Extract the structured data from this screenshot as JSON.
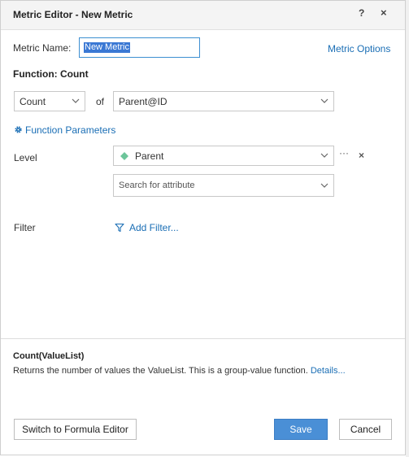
{
  "dialog": {
    "title": "Metric Editor - New Metric",
    "help_glyph": "?",
    "close_glyph": "×"
  },
  "metric": {
    "name_label": "Metric Name:",
    "name_value": "New Metric",
    "options_link": "Metric Options"
  },
  "function": {
    "heading": "Function: Count",
    "selected": "Count",
    "of_label": "of",
    "argument": "Parent@ID",
    "parameters_link": "Function Parameters"
  },
  "level": {
    "label": "Level",
    "selected": "Parent",
    "more_glyph": "···",
    "remove_glyph": "×",
    "search_placeholder": "Search for attribute"
  },
  "filter": {
    "label": "Filter",
    "add_link": "Add Filter..."
  },
  "description": {
    "title": "Count(ValueList)",
    "text": "Returns the number of values the ValueList. This is a group-value function.",
    "details_link": "Details..."
  },
  "buttons": {
    "formula_editor": "Switch to Formula Editor",
    "save": "Save",
    "cancel": "Cancel"
  },
  "colors": {
    "accent": "#1a6eb5",
    "save_button": "#4a8fd6",
    "level_diamond": "#6cc59a"
  }
}
